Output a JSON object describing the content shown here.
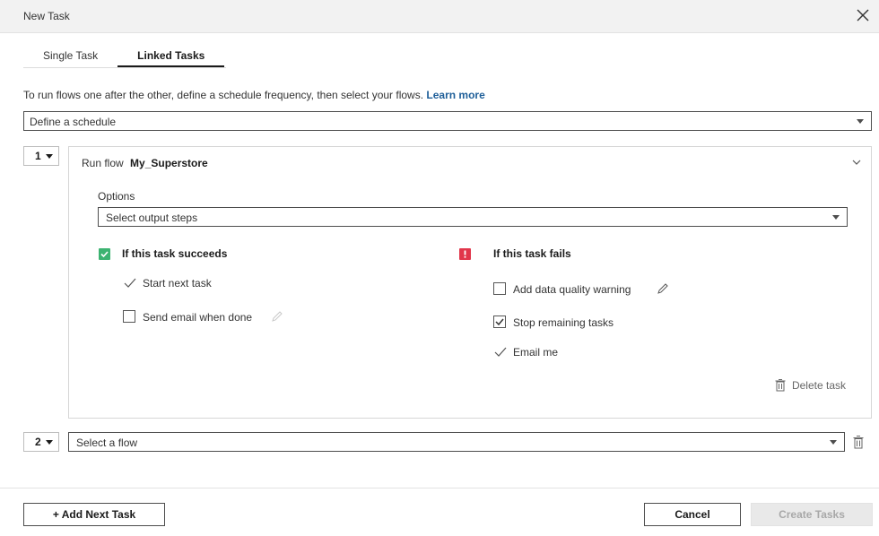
{
  "dialog": {
    "title": "New Task"
  },
  "tabs": [
    {
      "label": "Single Task",
      "active": false
    },
    {
      "label": "Linked Tasks",
      "active": true
    }
  ],
  "intro": {
    "text": "To run flows one after the other, define a schedule frequency, then select your flows.",
    "link": "Learn more"
  },
  "schedule": {
    "value": "Define a schedule"
  },
  "task1": {
    "number": "1",
    "run_label": "Run flow",
    "flow_name": "My_Superstore",
    "options_label": "Options",
    "output_select": "Select output steps",
    "success": {
      "heading": "If this task succeeds",
      "start_next": "Start next task",
      "send_email": "Send email when done",
      "send_email_checked": false
    },
    "failure": {
      "heading": "If this task fails",
      "add_warning": "Add data quality warning",
      "add_warning_checked": false,
      "stop_remaining": "Stop remaining tasks",
      "stop_remaining_checked": true,
      "email_me": "Email me"
    },
    "delete_label": "Delete task"
  },
  "task2": {
    "number": "2",
    "flow_select": "Select a flow"
  },
  "footer": {
    "add_next": "+ Add Next Task",
    "cancel": "Cancel",
    "create": "Create Tasks"
  },
  "colors": {
    "success_badge": "#3cb371",
    "failure_badge": "#e1364b",
    "link": "#1f5f99",
    "disabled_button": "#e9e9e9"
  }
}
